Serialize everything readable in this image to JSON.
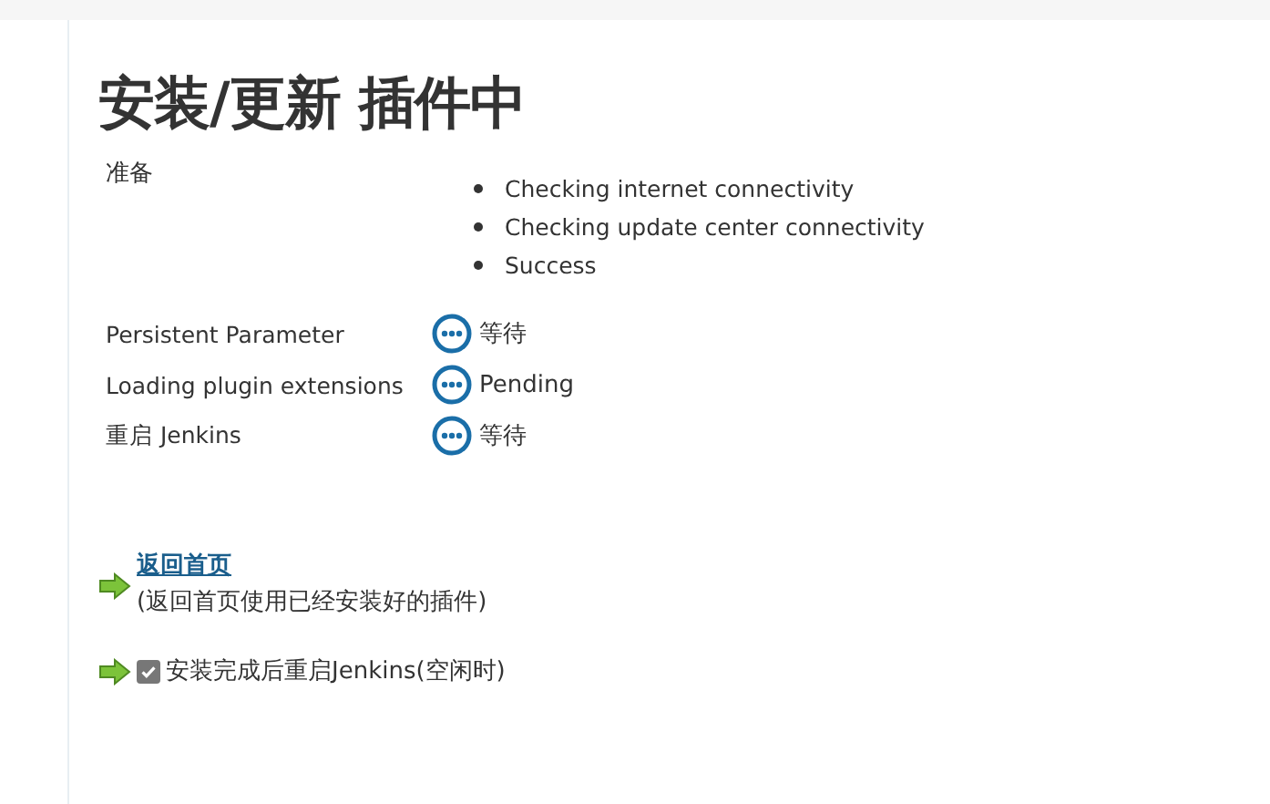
{
  "title": "安装/更新 插件中",
  "preparation": {
    "label": "准备",
    "steps": [
      "Checking internet connectivity",
      "Checking update center connectivity",
      "Success"
    ]
  },
  "jobs": [
    {
      "name": "Persistent Parameter",
      "kind": "pending",
      "status_text": "等待"
    },
    {
      "name": "Loading plugin extensions",
      "kind": "pending",
      "status_text": "Pending"
    },
    {
      "name": "重启 Jenkins",
      "kind": "pending",
      "status_text": "等待"
    }
  ],
  "back_link": {
    "label": "返回首页",
    "note": "(返回首页使用已经安装好的插件)"
  },
  "restart_option": {
    "label": "安装完成后重启Jenkins(空闲时)",
    "checked": true
  }
}
